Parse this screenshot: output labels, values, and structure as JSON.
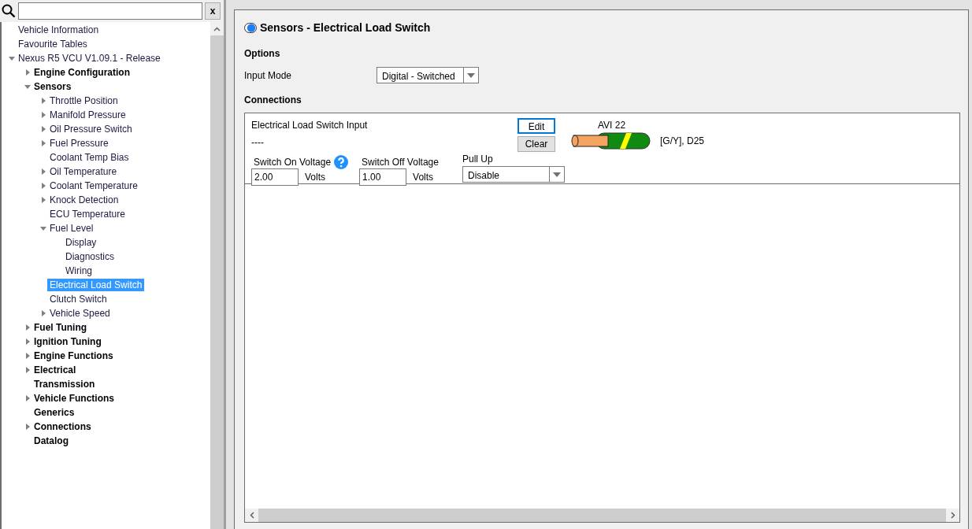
{
  "search": {
    "clear_label": "x"
  },
  "tree": [
    {
      "label": "Vehicle Information",
      "selected": false
    },
    {
      "label": "Favourite Tables",
      "selected": false
    },
    {
      "label": "Nexus R5 VCU V1.09.1 - Release",
      "selected": false,
      "expanded": true,
      "children": [
        {
          "label": "Engine Configuration",
          "selected": false,
          "expanded": false
        },
        {
          "label": "Sensors",
          "selected": false,
          "expanded": true,
          "children": [
            {
              "label": "Throttle Position",
              "selected": false,
              "expanded": false
            },
            {
              "label": "Manifold Pressure",
              "selected": false,
              "expanded": false
            },
            {
              "label": "Oil Pressure Switch",
              "selected": false,
              "expanded": false
            },
            {
              "label": "Fuel Pressure",
              "selected": false,
              "expanded": false
            },
            {
              "label": "Coolant Temp Bias",
              "selected": false
            },
            {
              "label": "Oil Temperature",
              "selected": false,
              "expanded": false
            },
            {
              "label": "Coolant Temperature",
              "selected": false,
              "expanded": false
            },
            {
              "label": "Knock Detection",
              "selected": false,
              "expanded": false
            },
            {
              "label": "ECU Temperature",
              "selected": false
            },
            {
              "label": "Fuel Level",
              "selected": false,
              "expanded": true,
              "children": [
                {
                  "label": "Display",
                  "selected": false
                },
                {
                  "label": "Diagnostics",
                  "selected": false
                },
                {
                  "label": "Wiring",
                  "selected": false
                }
              ]
            },
            {
              "label": "Electrical Load Switch",
              "selected": true
            },
            {
              "label": "Clutch Switch",
              "selected": false
            },
            {
              "label": "Vehicle Speed",
              "selected": false,
              "expanded": false
            }
          ]
        },
        {
          "label": "Fuel Tuning",
          "selected": false,
          "expanded": false
        },
        {
          "label": "Ignition Tuning",
          "selected": false,
          "expanded": false
        },
        {
          "label": "Engine Functions",
          "selected": false,
          "expanded": false
        },
        {
          "label": "Electrical",
          "selected": false,
          "expanded": false
        },
        {
          "label": "Transmission",
          "selected": false
        },
        {
          "label": "Vehicle Functions",
          "selected": false,
          "expanded": false
        },
        {
          "label": "Generics",
          "selected": false
        },
        {
          "label": "Connections",
          "selected": false,
          "expanded": false
        },
        {
          "label": "Datalog",
          "selected": false
        }
      ]
    }
  ],
  "page": {
    "title": "Sensors - Electrical Load Switch",
    "options_heading": "Options",
    "input_mode_label": "Input Mode",
    "input_mode_value": "Digital - Switched",
    "connections_heading": "Connections"
  },
  "connection": {
    "name": "Electrical Load Switch Input",
    "value": "----",
    "edit_label": "Edit",
    "clear_label": "Clear",
    "pin_label": "AVI 22",
    "wire_label": "[G/Y], D25",
    "fields": [
      {
        "label": "Switch On Voltage",
        "value": "2.00",
        "unit": "Volts",
        "help": true
      },
      {
        "label": "Switch Off Voltage",
        "value": "1.00",
        "unit": "Volts",
        "help": false
      }
    ],
    "pull_up": {
      "label": "Pull Up",
      "value": "Disable"
    }
  }
}
